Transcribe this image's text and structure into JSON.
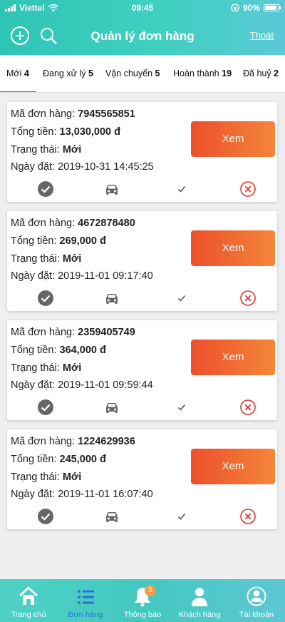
{
  "status": {
    "carrier": "Viettel",
    "time": "09:45",
    "battery": "90%",
    "battery_level": 0.9
  },
  "header": {
    "title": "Quản lý đơn hàng",
    "logout": "Thoát"
  },
  "tabs": [
    {
      "label": "Mới",
      "count": "4"
    },
    {
      "label": "Đang xử lý",
      "count": "5"
    },
    {
      "label": "Vận chuyển",
      "count": "5"
    },
    {
      "label": "Hoàn thành",
      "count": "19"
    },
    {
      "label": "Đã huỷ",
      "count": "2"
    }
  ],
  "orders": [
    {
      "id_label": "Mã đơn hàng:",
      "id": "7945565851",
      "total_label": "Tổng tiền:",
      "total": "13,030,000 đ",
      "status_label": "Trạng thái:",
      "status": "Mới",
      "date_label": "Ngày đặt:",
      "date": "2019-10-31 14:45:25",
      "view": "Xem"
    },
    {
      "id_label": "Mã đơn hàng:",
      "id": "4672878480",
      "total_label": "Tổng tiền:",
      "total": "269,000 đ",
      "status_label": "Trạng thái:",
      "status": "Mới",
      "date_label": "Ngày đặt:",
      "date": "2019-11-01 09:17:40",
      "view": "Xem"
    },
    {
      "id_label": "Mã đơn hàng:",
      "id": "2359405749",
      "total_label": "Tổng tiền:",
      "total": "364,000 đ",
      "status_label": "Trạng thái:",
      "status": "Mới",
      "date_label": "Ngày đặt:",
      "date": "2019-11-01 09:59:44",
      "view": "Xem"
    },
    {
      "id_label": "Mã đơn hàng:",
      "id": "1224629936",
      "total_label": "Tổng tiền:",
      "total": "245,000 đ",
      "status_label": "Trạng thái:",
      "status": "Mới",
      "date_label": "Ngày đặt:",
      "date": "2019-11-01 16:07:40",
      "view": "Xem"
    }
  ],
  "bottom_nav": [
    {
      "label": "Trang chủ",
      "icon": "home-icon"
    },
    {
      "label": "Đơn hàng",
      "icon": "list-icon"
    },
    {
      "label": "Thông báo",
      "icon": "bell-icon",
      "badge": "5"
    },
    {
      "label": "Khách hàng",
      "icon": "person-icon"
    },
    {
      "label": "Tài khoản",
      "icon": "account-icon"
    }
  ],
  "colors": {
    "header": "#3fd0c0",
    "accent": "#2e7de1",
    "button": "#ef6a31",
    "cancel": "#e0312f"
  }
}
